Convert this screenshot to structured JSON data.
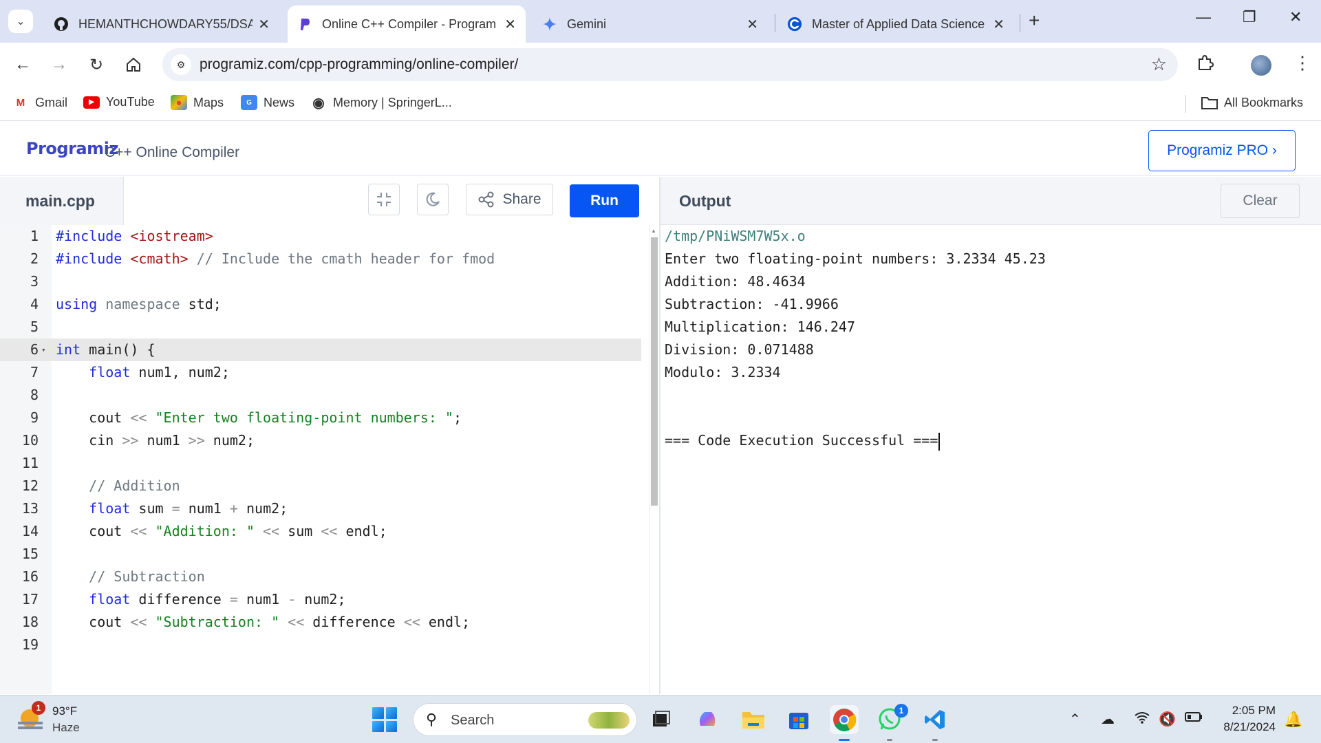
{
  "browser": {
    "tabs": [
      {
        "title": "HEMANTHCHOWDARY55/DSAC",
        "icon": "github-icon"
      },
      {
        "title": "Online C++ Compiler - Program",
        "icon": "programiz-icon",
        "active": true
      },
      {
        "title": "Gemini",
        "icon": "gemini-icon"
      },
      {
        "title": "Master of Applied Data Science",
        "icon": "coursera-icon"
      }
    ],
    "url": "programiz.com/cpp-programming/online-compiler/",
    "bookmarks": [
      {
        "label": "Gmail",
        "icon": "gmail-icon"
      },
      {
        "label": "YouTube",
        "icon": "youtube-icon"
      },
      {
        "label": "Maps",
        "icon": "maps-icon"
      },
      {
        "label": "News",
        "icon": "news-icon"
      },
      {
        "label": "Memory | SpringerL...",
        "icon": "springer-icon"
      }
    ],
    "all_bookmarks": "All Bookmarks"
  },
  "site": {
    "logo": "Programiz",
    "subtitle": "C++ Online Compiler",
    "pro_button": "Programiz PRO ›"
  },
  "editor": {
    "filename": "main.cpp",
    "share_label": "Share",
    "run_label": "Run",
    "active_line": 6,
    "lines": [
      {
        "n": "1",
        "tokens": [
          [
            "kw",
            "#include "
          ],
          [
            "inc",
            "<iostream>"
          ]
        ]
      },
      {
        "n": "2",
        "tokens": [
          [
            "kw",
            "#include "
          ],
          [
            "inc",
            "<cmath>"
          ],
          [
            "com",
            " // Include the cmath header for fmod"
          ]
        ]
      },
      {
        "n": "3",
        "tokens": []
      },
      {
        "n": "4",
        "tokens": [
          [
            "kw",
            "using "
          ],
          [
            "ns",
            "namespace "
          ],
          [
            "",
            "std;"
          ]
        ]
      },
      {
        "n": "5",
        "tokens": []
      },
      {
        "n": "6",
        "fold": true,
        "tokens": [
          [
            "kw",
            "int "
          ],
          [
            "",
            "main() {"
          ]
        ]
      },
      {
        "n": "7",
        "tokens": [
          [
            "",
            "    "
          ],
          [
            "kw",
            "float "
          ],
          [
            "",
            "num1, num2;"
          ]
        ]
      },
      {
        "n": "8",
        "tokens": []
      },
      {
        "n": "9",
        "tokens": [
          [
            "",
            "    cout "
          ],
          [
            "op",
            "<< "
          ],
          [
            "str",
            "\"Enter two floating-point numbers: \""
          ],
          [
            "",
            ";"
          ]
        ]
      },
      {
        "n": "10",
        "tokens": [
          [
            "",
            "    cin "
          ],
          [
            "op",
            ">> "
          ],
          [
            "",
            "num1 "
          ],
          [
            "op",
            ">> "
          ],
          [
            "",
            "num2;"
          ]
        ]
      },
      {
        "n": "11",
        "tokens": []
      },
      {
        "n": "12",
        "tokens": [
          [
            "com",
            "    // Addition"
          ]
        ]
      },
      {
        "n": "13",
        "tokens": [
          [
            "",
            "    "
          ],
          [
            "kw",
            "float "
          ],
          [
            "",
            "sum "
          ],
          [
            "op",
            "= "
          ],
          [
            "",
            "num1 "
          ],
          [
            "op",
            "+ "
          ],
          [
            "",
            "num2;"
          ]
        ]
      },
      {
        "n": "14",
        "tokens": [
          [
            "",
            "    cout "
          ],
          [
            "op",
            "<< "
          ],
          [
            "str",
            "\"Addition: \""
          ],
          [
            "",
            " "
          ],
          [
            "op",
            "<< "
          ],
          [
            "",
            "sum "
          ],
          [
            "op",
            "<< "
          ],
          [
            "",
            "endl;"
          ]
        ]
      },
      {
        "n": "15",
        "tokens": []
      },
      {
        "n": "16",
        "tokens": [
          [
            "com",
            "    // Subtraction"
          ]
        ]
      },
      {
        "n": "17",
        "tokens": [
          [
            "",
            "    "
          ],
          [
            "kw",
            "float "
          ],
          [
            "",
            "difference "
          ],
          [
            "op",
            "= "
          ],
          [
            "",
            "num1 "
          ],
          [
            "op",
            "- "
          ],
          [
            "",
            "num2;"
          ]
        ]
      },
      {
        "n": "18",
        "tokens": [
          [
            "",
            "    cout "
          ],
          [
            "op",
            "<< "
          ],
          [
            "str",
            "\"Subtraction: \""
          ],
          [
            "",
            " "
          ],
          [
            "op",
            "<< "
          ],
          [
            "",
            "difference "
          ],
          [
            "op",
            "<< "
          ],
          [
            "",
            "endl;"
          ]
        ]
      },
      {
        "n": "19",
        "tokens": []
      }
    ]
  },
  "output": {
    "title": "Output",
    "clear_label": "Clear",
    "path": "/tmp/PNiWSM7W5x.o",
    "lines": [
      "Enter two floating-point numbers: 3.2334 45.23",
      "Addition: 48.4634",
      "Subtraction: -41.9966",
      "Multiplication: 146.247",
      "Division: 0.071488",
      "Modulo: 3.2334"
    ],
    "status": "=== Code Execution Successful ==="
  },
  "taskbar": {
    "weather_temp": "93°F",
    "weather_desc": "Haze",
    "weather_badge": "1",
    "search_placeholder": "Search",
    "whatsapp_badge": "1",
    "time": "2:05 PM",
    "date": "8/21/2024"
  },
  "colors": {
    "accent": "#0556f3",
    "tabstrip": "#dde3f4",
    "keyword": "#1f2bdc",
    "string": "#15801f"
  }
}
